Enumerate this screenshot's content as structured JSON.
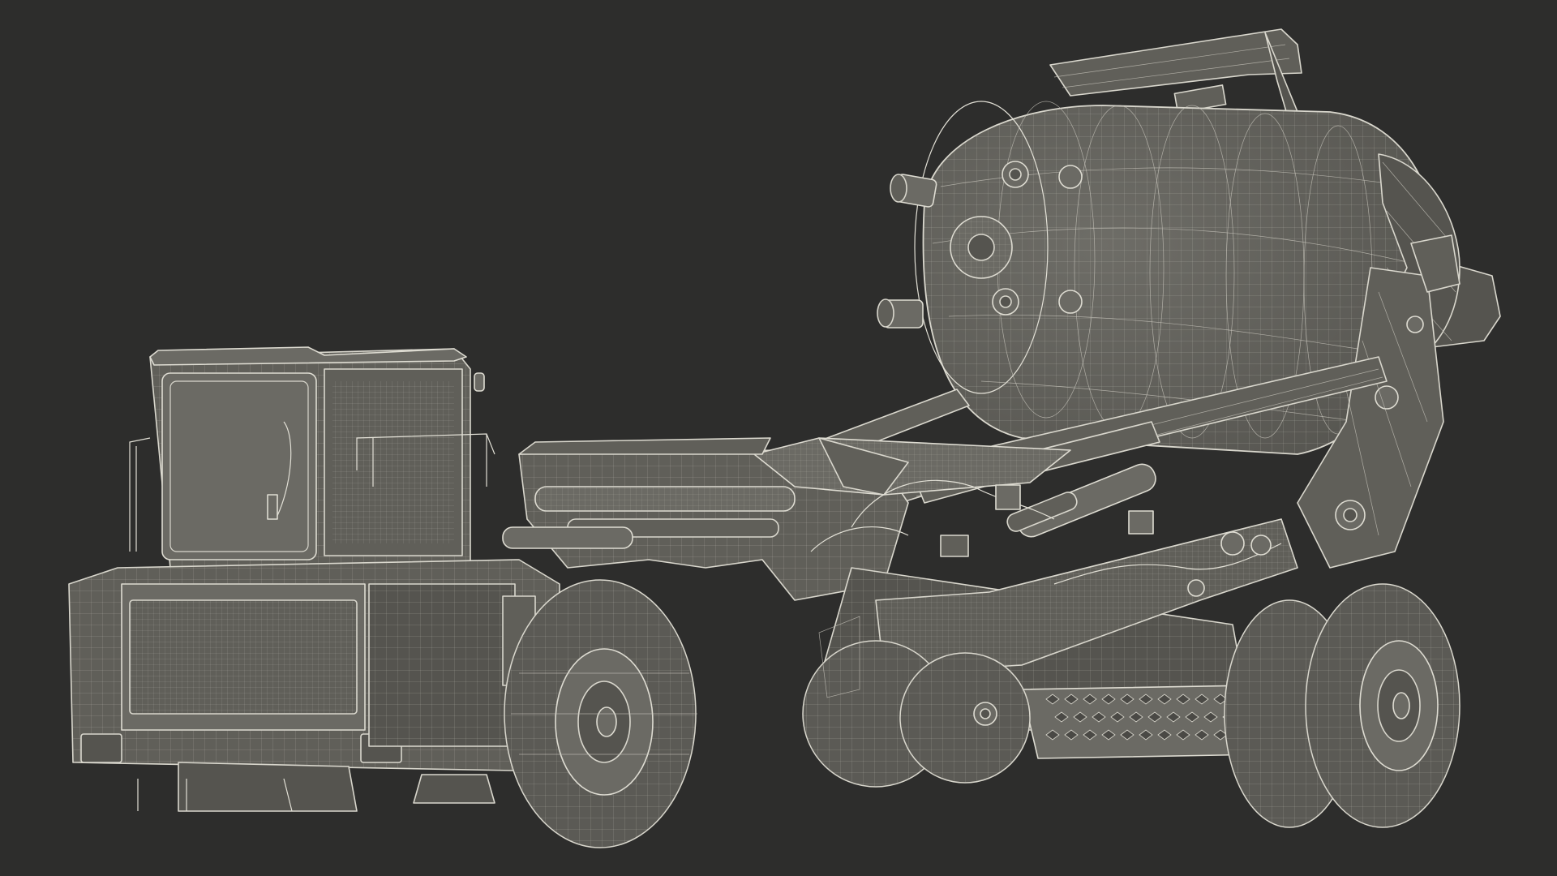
{
  "scene": {
    "background_color": "#2d2d2c",
    "subject": "mixer-truck-wireframe",
    "render_style": "wireframe-shaded",
    "line_color": "#d9d7cd",
    "surface_color": "#605f59"
  }
}
